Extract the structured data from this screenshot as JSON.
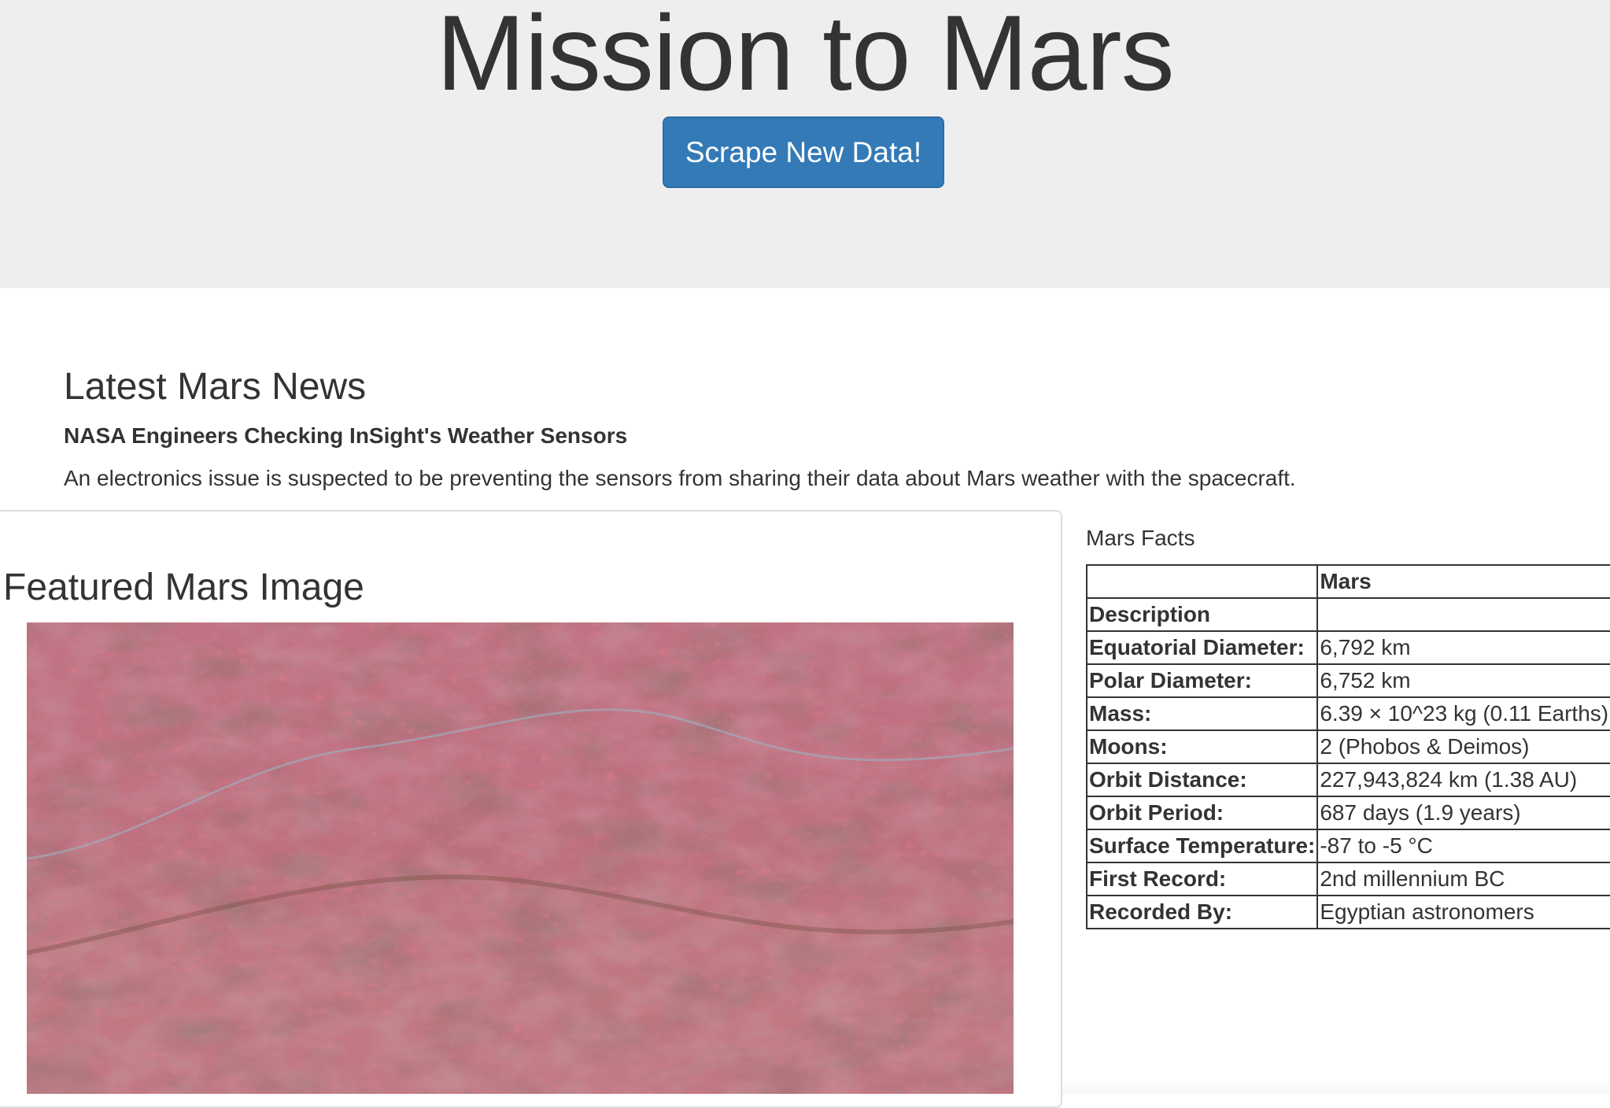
{
  "header": {
    "title": "Mission to Mars",
    "scrape_button_label": "Scrape New Data!"
  },
  "news": {
    "heading": "Latest Mars News",
    "title": "NASA Engineers Checking InSight's Weather Sensors",
    "paragraph": "An electronics issue is suspected to be preventing the sensors from sharing their data about Mars weather with the spacecraft."
  },
  "featured_image": {
    "heading": "Featured Mars Image",
    "image_icon": "mars-terrain-image"
  },
  "facts": {
    "heading": "Mars Facts",
    "column_header_blank": "",
    "column_header": "Mars",
    "rows": [
      {
        "label": "Description",
        "value": ""
      },
      {
        "label": "Equatorial Diameter:",
        "value": "6,792 km"
      },
      {
        "label": "Polar Diameter:",
        "value": "6,752 km"
      },
      {
        "label": "Mass:",
        "value": "6.39 × 10^23 kg (0.11 Earths)"
      },
      {
        "label": "Moons:",
        "value": "2 (Phobos & Deimos)"
      },
      {
        "label": "Orbit Distance:",
        "value": "227,943,824 km (1.38 AU)"
      },
      {
        "label": "Orbit Period:",
        "value": "687 days (1.9 years)"
      },
      {
        "label": "Surface Temperature:",
        "value": "-87 to -5 °C"
      },
      {
        "label": "First Record:",
        "value": "2nd millennium BC"
      },
      {
        "label": "Recorded By:",
        "value": "Egyptian astronomers"
      }
    ]
  },
  "colors": {
    "jumbotron_bg": "#eeeeee",
    "button_primary": "#337ab7",
    "text": "#333333"
  }
}
